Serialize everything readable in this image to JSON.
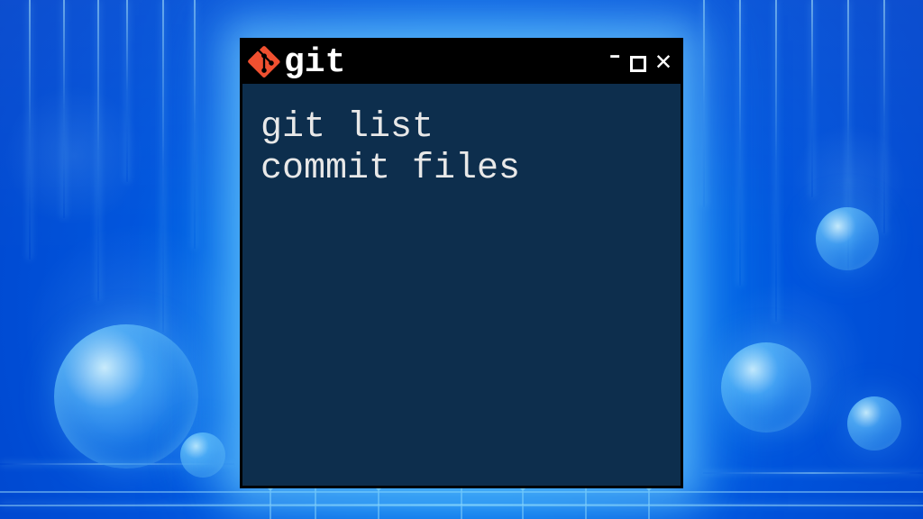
{
  "window": {
    "title": "git",
    "icon": "git-icon"
  },
  "terminal": {
    "content": "git list\ncommit files"
  }
}
